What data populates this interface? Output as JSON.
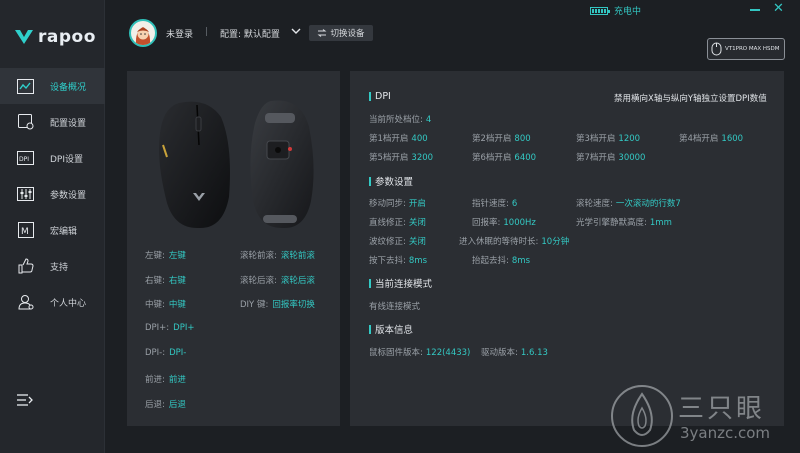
{
  "app": {
    "brand": "rapoo"
  },
  "sidebar": {
    "items": [
      {
        "label": "设备概况",
        "icon": "chart-icon"
      },
      {
        "label": "配置设置",
        "icon": "config-icon"
      },
      {
        "label": "DPI设置",
        "icon": "dpi-icon"
      },
      {
        "label": "参数设置",
        "icon": "sliders-icon"
      },
      {
        "label": "宏编辑",
        "icon": "macro-icon"
      },
      {
        "label": "支持",
        "icon": "thumbs-up-icon"
      },
      {
        "label": "个人中心",
        "icon": "user-icon"
      }
    ]
  },
  "header": {
    "user": "未登录",
    "separator": "|",
    "config": "配置: 默认配置",
    "switch_label": "切换设备",
    "charge_label": "充电中",
    "device_name": "VT1PRO MAX HSDM"
  },
  "bindings": {
    "left": [
      {
        "key": "左键:",
        "value": "左键"
      },
      {
        "key": "右键:",
        "value": "右键"
      },
      {
        "key": "中键:",
        "value": "中键"
      },
      {
        "key": "DPI+:",
        "value": "DPI+"
      },
      {
        "key": "DPI-:",
        "value": "DPI-"
      },
      {
        "key": "前进:",
        "value": "前进"
      },
      {
        "key": "后退:",
        "value": "后退"
      }
    ],
    "right": [
      {
        "key": "滚轮前滚:",
        "value": "滚轮前滚"
      },
      {
        "key": "滚轮后滚:",
        "value": "滚轮后滚"
      },
      {
        "key": "DIY 键:",
        "value": "回报率切换"
      }
    ]
  },
  "dpi": {
    "title": "DPI",
    "note": "禁用横向X轴与纵向Y轴独立设置DPI数值",
    "current_key": "当前所处档位:",
    "current_value": "4",
    "levels": [
      {
        "key": "第1档开启",
        "value": "400"
      },
      {
        "key": "第2档开启",
        "value": "800"
      },
      {
        "key": "第3档开启",
        "value": "1200"
      },
      {
        "key": "第4档开启",
        "value": "1600"
      },
      {
        "key": "第5档开启",
        "value": "3200"
      },
      {
        "key": "第6档开启",
        "value": "6400"
      },
      {
        "key": "第7档开启",
        "value": "30000"
      }
    ]
  },
  "params": {
    "title": "参数设置",
    "items": [
      {
        "key": "移动同步:",
        "value": "开启"
      },
      {
        "key": "指针速度:",
        "value": "6"
      },
      {
        "key": "滚轮速度:",
        "value": "一次滚动的行数7"
      },
      {
        "key": "直线修正:",
        "value": "关闭"
      },
      {
        "key": "回报率:",
        "value": "1000Hz"
      },
      {
        "key": "光学引擎静默高度:",
        "value": "1mm"
      },
      {
        "key": "波纹修正:",
        "value": "关闭"
      },
      {
        "key": "进入休眠的等待时长:",
        "value": "10分钟"
      },
      {
        "key": "按下去抖:",
        "value": "8ms"
      },
      {
        "key": "抬起去抖:",
        "value": "8ms"
      }
    ]
  },
  "connection": {
    "title": "当前连接模式",
    "mode": "有线连接模式"
  },
  "version": {
    "title": "版本信息",
    "firmware_key": "鼠标固件版本:",
    "firmware_value": "122(4433)",
    "driver_key": "驱动版本:",
    "driver_value": "1.6.13"
  },
  "watermark": {
    "text": "三只眼",
    "url": "3yanzc.com"
  },
  "colors": {
    "accent": "#33c9c4",
    "bg": "#1c1f23",
    "panel": "#2b2e33",
    "sidebar": "#24272c"
  }
}
